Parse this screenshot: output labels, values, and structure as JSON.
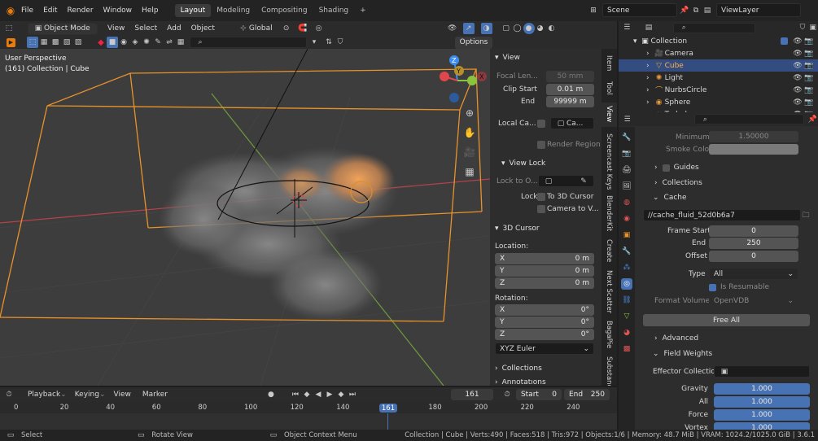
{
  "menu": [
    "File",
    "Edit",
    "Render",
    "Window",
    "Help"
  ],
  "workspaces": [
    "Layout",
    "Modeling",
    "Compositing",
    "Shading"
  ],
  "add_tab": "+",
  "scene": "Scene",
  "view_layer": "ViewLayer",
  "header": {
    "mode": "Object Mode",
    "view": "View",
    "select": "Select",
    "add": "Add",
    "object": "Object",
    "transform": "Global",
    "options": "Options"
  },
  "viewport": {
    "title": "User Perspective",
    "subtitle": "(161) Collection | Cube"
  },
  "nav_gizmo": {
    "x": "X",
    "y": "Y",
    "z": "Z"
  },
  "sidebar_tabs": [
    "Item",
    "Tool",
    "View",
    "Screencast Keys",
    "BlenderKit",
    "Create",
    "Next Scatter",
    "BagaPie",
    "Substance"
  ],
  "view_panel": {
    "title": "View",
    "focal_label": "Focal Len...",
    "focal_value": "50 mm",
    "clip_start_label": "Clip Start",
    "clip_start": "0.01 m",
    "end_label": "End",
    "clip_end": "99999 m",
    "local_camera_label": "Local Ca...",
    "local_camera_value": "Ca...",
    "render_region": "Render Region",
    "view_lock_title": "View Lock",
    "lock_to_label": "Lock to O...",
    "lock_label": "Lock",
    "lock_cursor": "To 3D Cursor",
    "lock_camera": "Camera to V...",
    "cursor_title": "3D Cursor",
    "location_label": "Location:",
    "loc": [
      {
        "axis": "X",
        "value": "0 m"
      },
      {
        "axis": "Y",
        "value": "0 m"
      },
      {
        "axis": "Z",
        "value": "0 m"
      }
    ],
    "rotation_label": "Rotation:",
    "rot": [
      {
        "axis": "X",
        "value": "0°"
      },
      {
        "axis": "Y",
        "value": "0°"
      },
      {
        "axis": "Z",
        "value": "0°"
      }
    ],
    "rot_mode": "XYZ Euler",
    "collections": "Collections",
    "annotations": "Annotations"
  },
  "outliner": {
    "root": "Collection",
    "items": [
      {
        "name": "Camera",
        "icon": "camera-icon",
        "color": "#e69a3c",
        "selected": false
      },
      {
        "name": "Cube",
        "icon": "cube-icon",
        "color": "#e69a3c",
        "selected": true
      },
      {
        "name": "Light",
        "icon": "light-icon",
        "color": "#e69a3c",
        "selected": false
      },
      {
        "name": "NurbsCircle",
        "icon": "curve-icon",
        "color": "#e69a3c",
        "selected": false
      },
      {
        "name": "Sphere",
        "icon": "sphere-icon",
        "color": "#e69a3c",
        "selected": false
      },
      {
        "name": "Turbulence",
        "icon": "force-icon",
        "color": "#e69a3c",
        "selected": false
      }
    ]
  },
  "properties": {
    "minimum_label": "Minimum",
    "minimum_value": "1.50000",
    "smoke_color_label": "Smoke Color",
    "guides": "Guides",
    "collections": "Collections",
    "cache": "Cache",
    "cache_path": "//cache_fluid_52d0b6a7",
    "frame_start_label": "Frame Start",
    "frame_start": "0",
    "end_label": "End",
    "end": "250",
    "offset_label": "Offset",
    "offset": "0",
    "type_label": "Type",
    "type_value": "All",
    "is_resumable": "Is Resumable",
    "format_volumes_label": "Format Volumes",
    "format_volumes_value": "OpenVDB",
    "free_all": "Free All",
    "advanced": "Advanced",
    "field_weights": "Field Weights",
    "effector_collection": "Effector Collection",
    "weights": [
      {
        "label": "Gravity",
        "value": "1.000"
      },
      {
        "label": "All",
        "value": "1.000"
      },
      {
        "label": "Force",
        "value": "1.000"
      },
      {
        "label": "Vortex",
        "value": "1.000"
      }
    ]
  },
  "timeline": {
    "playback": "Playback",
    "keying": "Keying",
    "view": "View",
    "marker": "Marker",
    "current_frame": "161",
    "start_label": "Start",
    "start": "0",
    "end_label": "End",
    "end": "250",
    "ticks": [
      "0",
      "20",
      "40",
      "60",
      "80",
      "100",
      "120",
      "140",
      "160",
      "180",
      "200",
      "220",
      "240"
    ],
    "playhead": "161"
  },
  "status": {
    "select": "Select",
    "rotate": "Rotate View",
    "context": "Object Context Menu",
    "info": "Collection | Cube | Verts:490 | Faces:518 | Tris:972 | Objects:1/6 | Memory: 48.7 MiB | VRAM: 1024.2/1025.0 GiB | 3.6.1"
  },
  "colors": {
    "accent": "#4772b3",
    "selection": "#e8922a",
    "x_axis": "#e0474c",
    "y_axis": "#8ac43f",
    "z_axis": "#3d8cf0"
  }
}
